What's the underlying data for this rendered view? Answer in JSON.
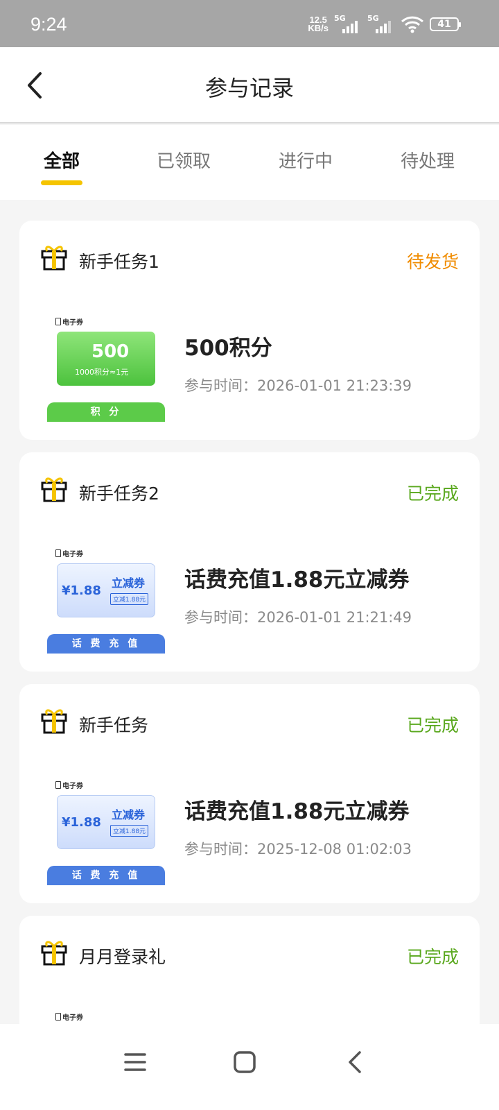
{
  "status_bar": {
    "time": "9:24",
    "net_speed_value": "12.5",
    "net_speed_unit": "KB/s",
    "sim1": "5G",
    "sim2": "5G",
    "battery": "41"
  },
  "header": {
    "title": "参与记录",
    "back_icon": "chevron-left-icon"
  },
  "tabs": [
    {
      "label": "全部",
      "active": true
    },
    {
      "label": "已领取",
      "active": false
    },
    {
      "label": "进行中",
      "active": false
    },
    {
      "label": "待处理",
      "active": false
    }
  ],
  "colors": {
    "accent": "#f5c400",
    "pending": "#f08c00",
    "done": "#5aa81e",
    "points_green": "#5ccb49",
    "coupon_blue": "#4a7de0"
  },
  "records": [
    {
      "task_name": "新手任务1",
      "status": "待发货",
      "status_type": "pending",
      "thumb": {
        "kind": "points",
        "badge": "电子券",
        "big": "500",
        "big_unit": "积分",
        "small": "1000积分≈1元",
        "band": "积 分"
      },
      "prize_title": "500积分",
      "time_label": "参与时间：2026-01-01 21:23:39"
    },
    {
      "task_name": "新手任务2",
      "status": "已完成",
      "status_type": "done",
      "thumb": {
        "kind": "coupon",
        "badge": "电子券",
        "amount": "¥1.88",
        "title": "立减券",
        "tag": "立减1.88元",
        "band": "话 费 充 值"
      },
      "prize_title": "话费充值1.88元立减券",
      "time_label": "参与时间：2026-01-01 21:21:49"
    },
    {
      "task_name": "新手任务",
      "status": "已完成",
      "status_type": "done",
      "thumb": {
        "kind": "coupon",
        "badge": "电子券",
        "amount": "¥1.88",
        "title": "立减券",
        "tag": "立减1.88元",
        "band": "话 费 充 值"
      },
      "prize_title": "话费充值1.88元立减券",
      "time_label": "参与时间：2025-12-08 01:02:03"
    },
    {
      "task_name": "月月登录礼",
      "status": "已完成",
      "status_type": "done",
      "thumb": {
        "kind": "partial",
        "badge": "电子券"
      }
    }
  ],
  "nav_bar": {
    "icons": [
      "menu-icon",
      "home-square-icon",
      "back-triangle-icon"
    ]
  }
}
